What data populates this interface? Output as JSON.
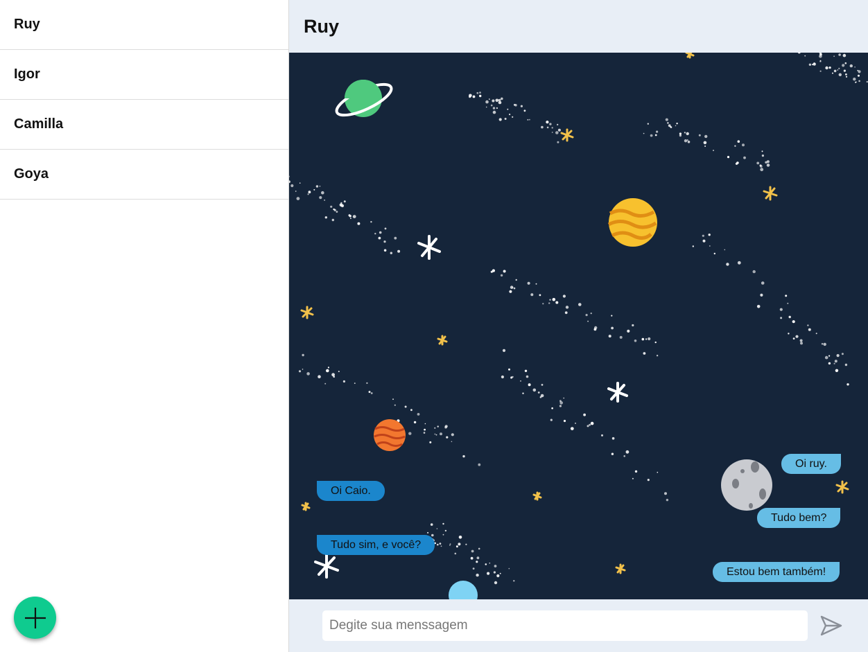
{
  "sidebar": {
    "contacts": [
      {
        "name": "Ruy"
      },
      {
        "name": "Igor"
      },
      {
        "name": "Camilla"
      },
      {
        "name": "Goya"
      }
    ],
    "add_button_icon": "plus-icon"
  },
  "chat": {
    "title": "Ruy",
    "messages": [
      {
        "text": "Oi ruy.",
        "direction": "out"
      },
      {
        "text": "Oi Caio.",
        "direction": "in"
      },
      {
        "text": "Tudo bem?",
        "direction": "out"
      },
      {
        "text": "Tudo sim, e você?",
        "direction": "in"
      },
      {
        "text": "Estou bem também!",
        "direction": "out"
      }
    ]
  },
  "composer": {
    "placeholder": "Degite sua menssagem",
    "value": "",
    "send_icon": "send-icon"
  },
  "colors": {
    "fab": "#0fcb8f",
    "header_bg": "#e8eef6",
    "chat_bg": "#15253a",
    "bubble_in": "#1b86cc",
    "bubble_out": "#66bde5"
  }
}
